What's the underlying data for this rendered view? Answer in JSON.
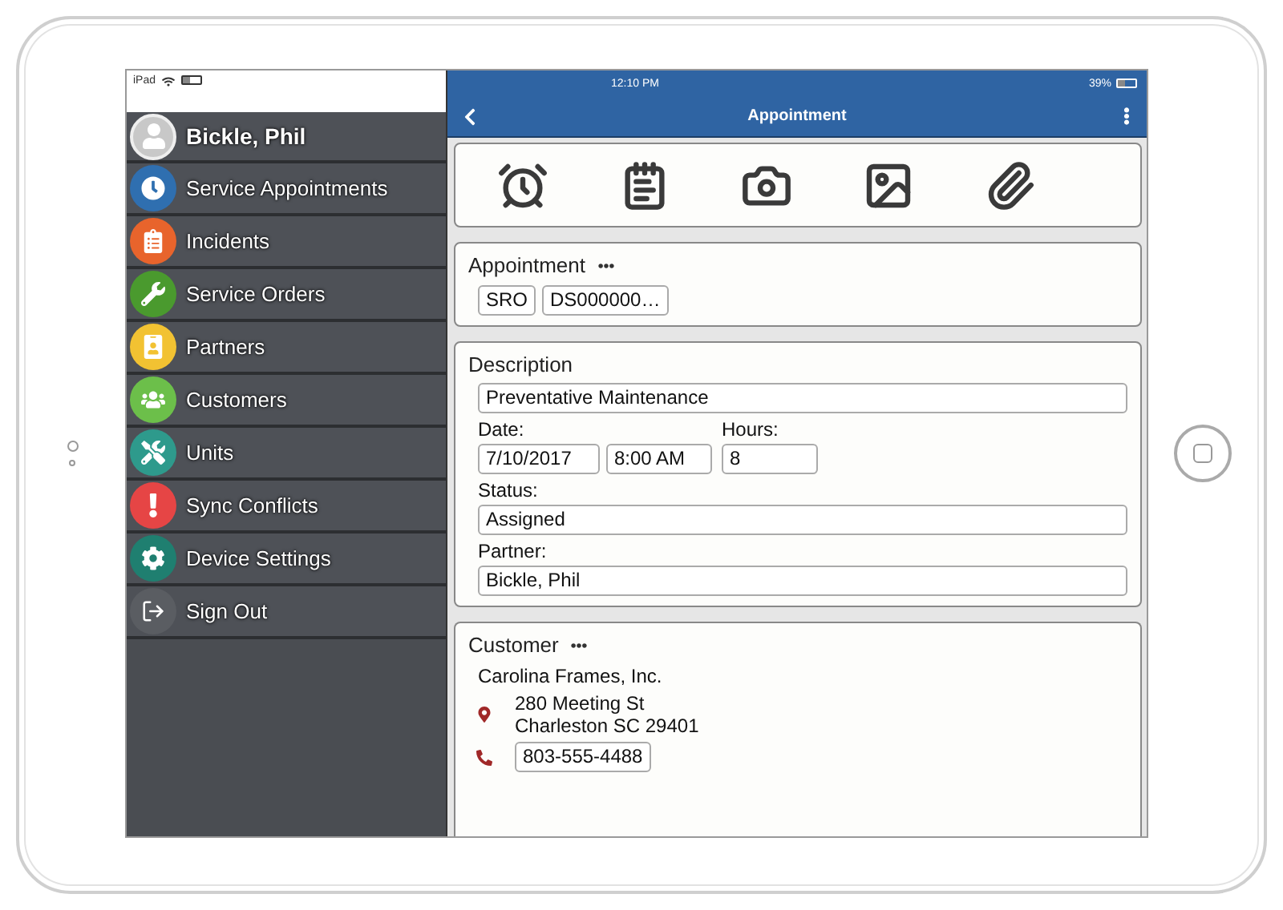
{
  "status_bar": {
    "device": "iPad",
    "time": "12:10 PM",
    "battery": "39%"
  },
  "sidebar": {
    "user": "Bickle, Phil",
    "items": [
      {
        "label": "Service Appointments",
        "color": "#2f6fb0"
      },
      {
        "label": "Incidents",
        "color": "#e8642c"
      },
      {
        "label": "Service Orders",
        "color": "#4a9a2e"
      },
      {
        "label": "Partners",
        "color": "#f2c232"
      },
      {
        "label": "Customers",
        "color": "#6cbf4a"
      },
      {
        "label": "Units",
        "color": "#2e9a8c"
      },
      {
        "label": "Sync Conflicts",
        "color": "#e64545"
      },
      {
        "label": "Device Settings",
        "color": "#1f7f70"
      },
      {
        "label": "Sign Out",
        "color": "#5a5d62"
      }
    ]
  },
  "nav_bar": {
    "title": "Appointment"
  },
  "appointment": {
    "title": "Appointment",
    "fields": [
      "SRO",
      "DS000000…"
    ]
  },
  "description": {
    "title": "Description",
    "value": "Preventative Maintenance",
    "date_label": "Date:",
    "date": "7/10/2017",
    "time": "8:00 AM",
    "hours_label": "Hours:",
    "hours": "8",
    "status_label": "Status:",
    "status": "Assigned",
    "partner_label": "Partner:",
    "partner": "Bickle, Phil"
  },
  "customer": {
    "title": "Customer",
    "name": "Carolina Frames, Inc.",
    "address": [
      "280 Meeting St",
      "Charleston SC 29401"
    ],
    "phone": "803-555-4488"
  }
}
